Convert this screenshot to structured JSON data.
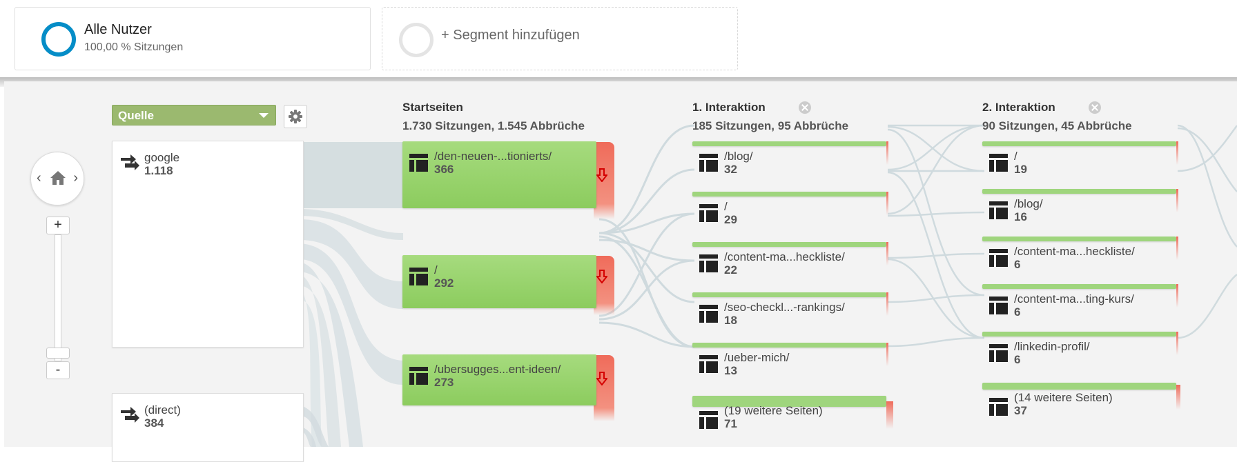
{
  "segments": {
    "all_users": {
      "title": "Alle Nutzer",
      "subtitle": "100,00 % Sitzungen"
    },
    "add": {
      "label": "+ Segment hinzufügen"
    }
  },
  "nav": {
    "left_glyph": "‹",
    "right_glyph": "›",
    "zoom_in": "+",
    "zoom_out": "-"
  },
  "dimension": {
    "selected": "Quelle"
  },
  "sources": [
    {
      "name": "google",
      "value": "1.118"
    },
    {
      "name": "(direct)",
      "value": "384"
    }
  ],
  "columns": {
    "start": {
      "title": "Startseiten",
      "stats": "1.730 Sitzungen, 1.545 Abbrüche"
    },
    "int1": {
      "title": "1. Interaktion",
      "stats": "185 Sitzungen, 95 Abbrüche"
    },
    "int2": {
      "title": "2. Interaktion",
      "stats": "90 Sitzungen, 45 Abbrüche"
    }
  },
  "start_pages": [
    {
      "label": "/den-neuen-...tionierts/",
      "value": "366"
    },
    {
      "label": "/",
      "value": "292"
    },
    {
      "label": "/ubersugges...ent-ideen/",
      "value": "273"
    }
  ],
  "interaction1": [
    {
      "label": "/blog/",
      "value": "32"
    },
    {
      "label": "/",
      "value": "29"
    },
    {
      "label": "/content-ma...heckliste/",
      "value": "22"
    },
    {
      "label": "/seo-checkl...-rankings/",
      "value": "18"
    },
    {
      "label": "/ueber-mich/",
      "value": "13"
    },
    {
      "label": "(19 weitere Seiten)",
      "value": "71"
    }
  ],
  "interaction2": [
    {
      "label": "/",
      "value": "19"
    },
    {
      "label": "/blog/",
      "value": "16"
    },
    {
      "label": "/content-ma...heckliste/",
      "value": "6"
    },
    {
      "label": "/content-ma...ting-kurs/",
      "value": "6"
    },
    {
      "label": "/linkedin-profil/",
      "value": "6"
    },
    {
      "label": "(14 weitere Seiten)",
      "value": "37"
    }
  ],
  "colors": {
    "accent_blue": "#058dc7",
    "node_green": "#8ccc5e",
    "dimension_green": "#9bb96f",
    "dropoff_red": "#ef6b5a",
    "flow_grey": "#d2dbde"
  },
  "icons": {
    "source": "source-arrows-icon",
    "page": "page-layout-icon",
    "dropoff": "dropoff-arrow-icon",
    "settings": "gear-icon",
    "home": "home-icon",
    "close": "close-icon"
  }
}
